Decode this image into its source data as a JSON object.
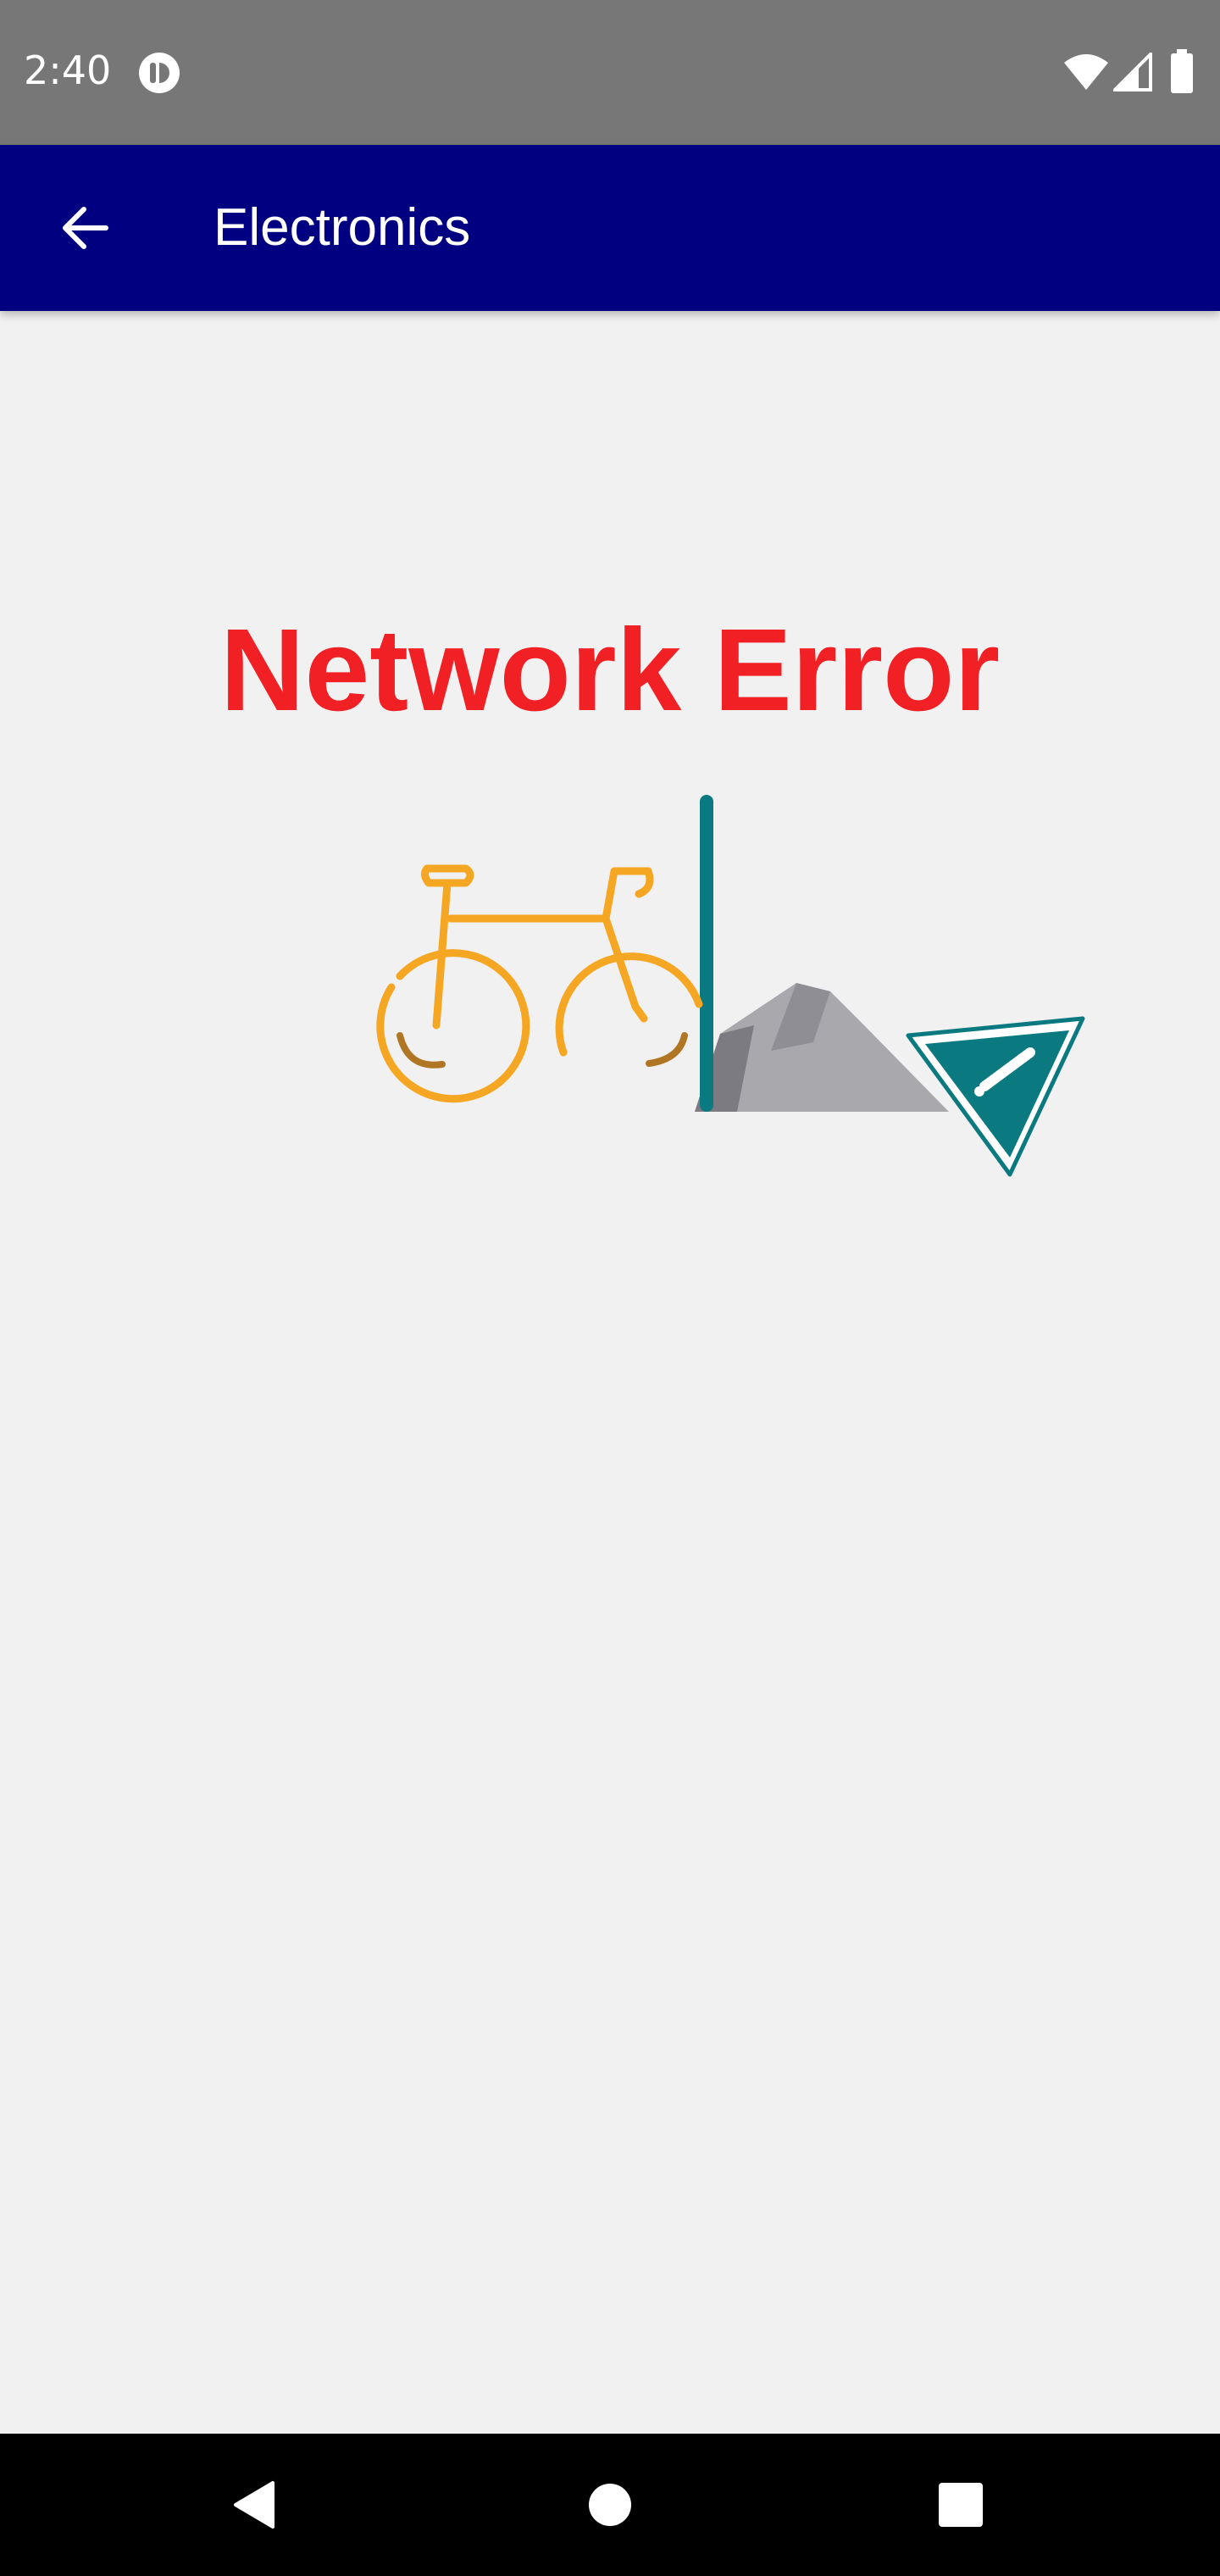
{
  "status_bar": {
    "time": "2:40",
    "icons": [
      "app-notification-icon",
      "wifi-icon",
      "signal-icon",
      "battery-icon"
    ]
  },
  "app_bar": {
    "title": "Electronics",
    "back_icon": "arrow-back-icon",
    "background": "#000080"
  },
  "content": {
    "error_title": "Network Error",
    "error_color": "#f12024",
    "illustration": "bicycle-rock-warning-sign-illustration"
  },
  "nav_bar": {
    "buttons": [
      "back-triangle-icon",
      "home-circle-icon",
      "recents-square-icon"
    ]
  },
  "colors": {
    "background": "#f2f1f1",
    "status_bar": "#777777",
    "bicycle": "#f5a623",
    "teal": "#0a7a80",
    "rock": "#a9a8ad"
  }
}
